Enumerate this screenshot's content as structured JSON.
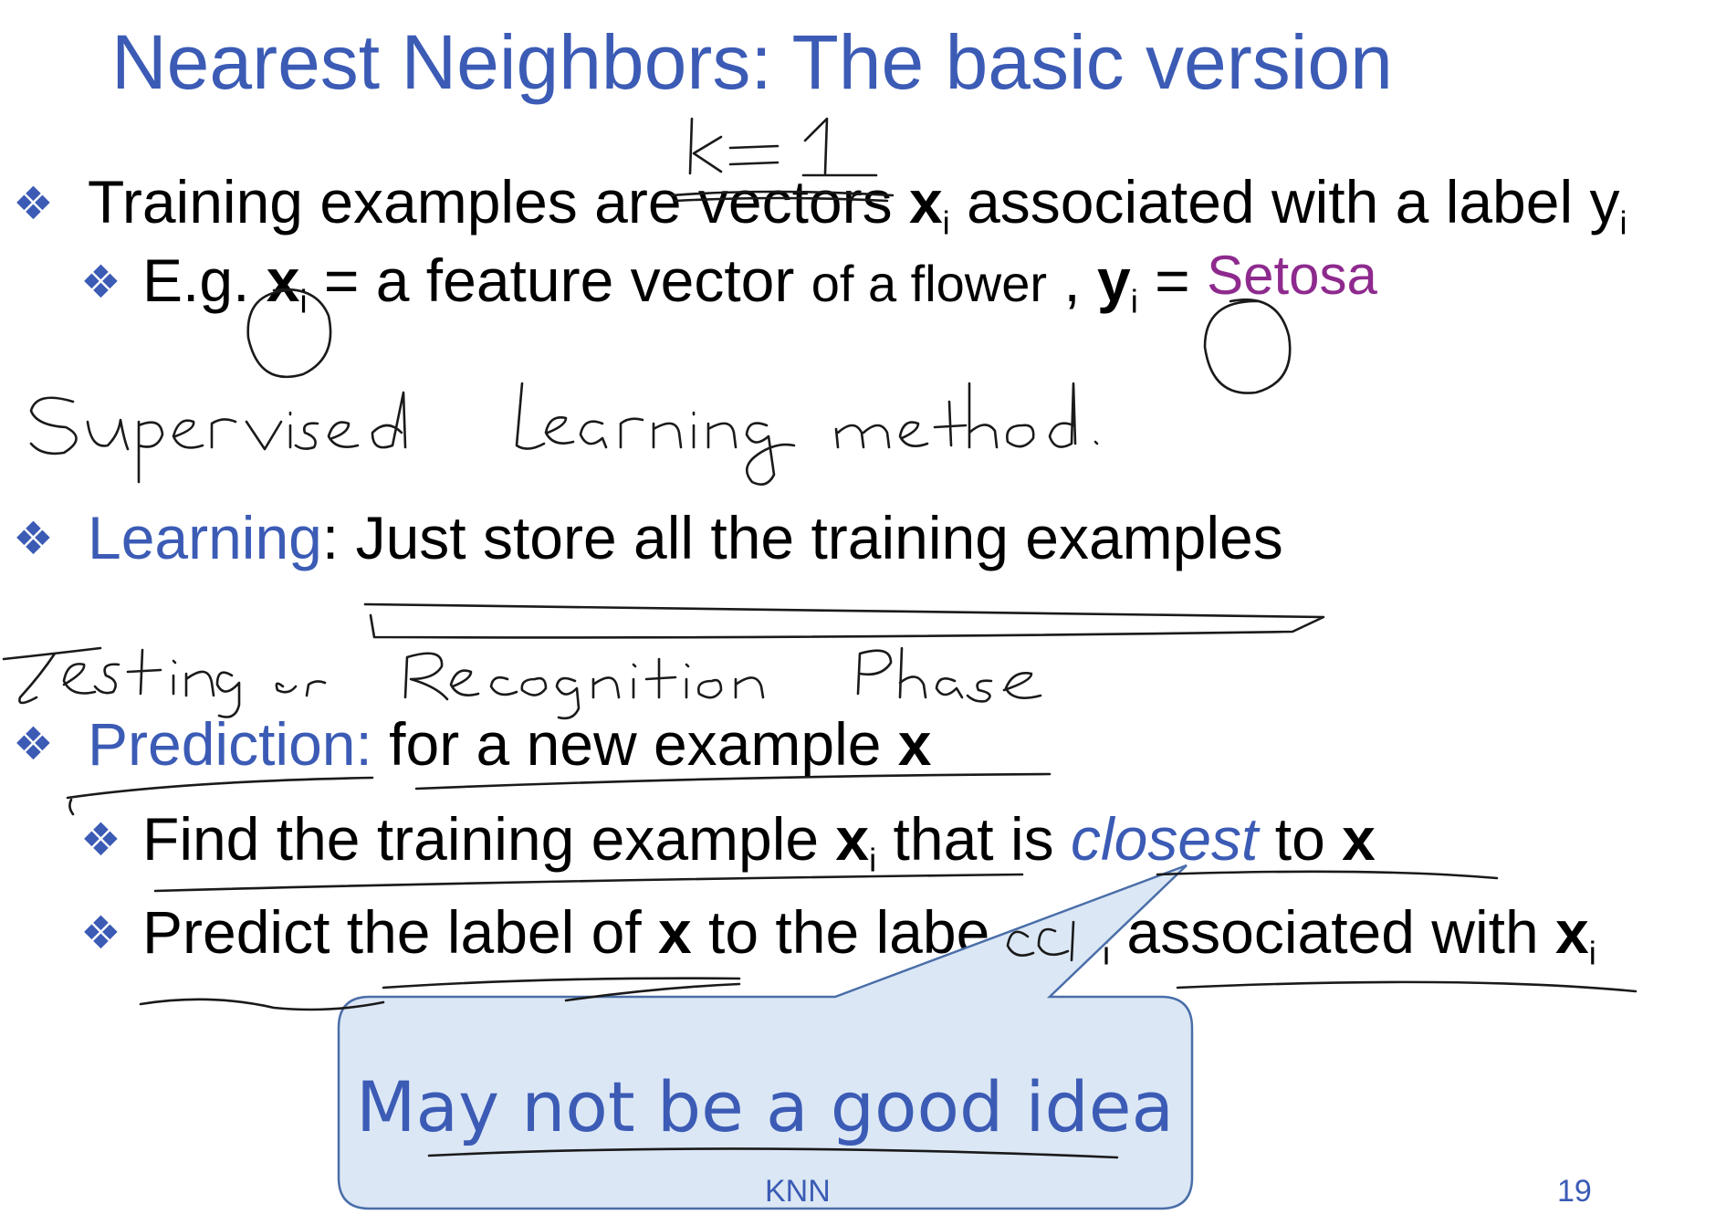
{
  "slide": {
    "title": "Nearest Neighbors: The basic version",
    "bullets": {
      "b1": {
        "pre": "Training examples are vectors ",
        "x": "x",
        "i": "i",
        "post": " associated with a label y",
        "sub": "i"
      },
      "b1a": {
        "pre": "E.g.",
        "x": "x",
        "i": "i",
        "mid": " = a feature vector ",
        "flower": "of a flower",
        "comma": " , ",
        "y": "y",
        "yi": "i",
        "eq": " = ",
        "label": "Setosa"
      },
      "b2": {
        "term": "Learning",
        "rest": ": Just store all the training examples"
      },
      "b3": {
        "term": "Prediction:",
        "rest": " for a new example ",
        "x": "x"
      },
      "b3a": {
        "pre": "Find the training example ",
        "x": "x",
        "i": "i",
        "mid": " that is ",
        "closest": "closest",
        "post": " to ",
        "x2": "x"
      },
      "b3b": {
        "pre": "Predict the label of ",
        "x": "x",
        "mid": " to the labe",
        "i": "i",
        "post": " associated with ",
        "x2": "x",
        "i2": "i"
      }
    },
    "callout": "May not be a good idea",
    "footer": {
      "center": "KNN",
      "page": "19"
    },
    "handwriting": {
      "k_eq": "k=1",
      "supervised": "Supervised learning method.",
      "testing": "Testing or Recognition Phase"
    },
    "colors": {
      "title": "#3b5bb5",
      "accent": "#3b5bb5",
      "setosa": "#8e2a8e",
      "callout_fill": "#dbe7f5",
      "callout_border": "#4a6ea8"
    }
  }
}
